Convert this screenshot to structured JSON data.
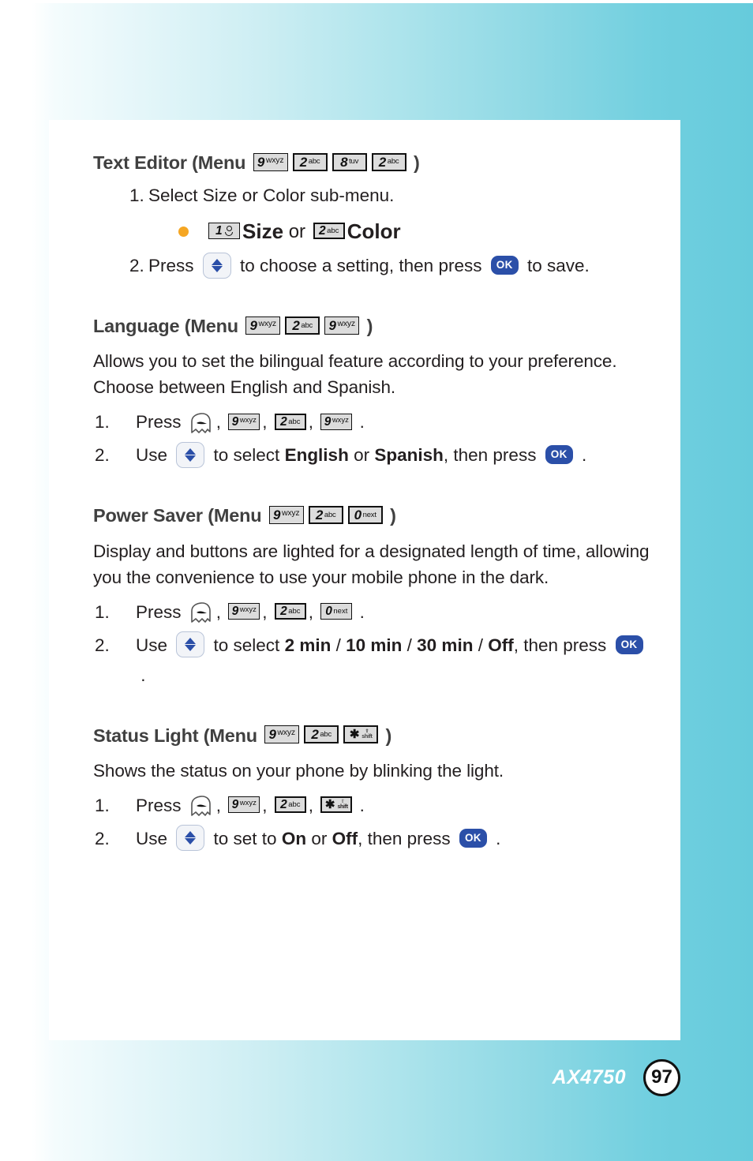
{
  "document": {
    "footer": {
      "model": "AX4750",
      "page_number": "97"
    }
  },
  "keys": {
    "k9": {
      "digit": "9",
      "letters": "wxyz"
    },
    "k2": {
      "digit": "2",
      "letters": "abc"
    },
    "k8": {
      "digit": "8",
      "letters": "tuv"
    },
    "k1": {
      "digit": "1",
      "letters": ""
    },
    "k0": {
      "digit": "0",
      "letters": "next"
    },
    "kstar": {
      "glyph": "✱",
      "label_top": "⇧",
      "label_bottom": "shift"
    },
    "ok": {
      "label": "OK"
    }
  },
  "sections": [
    {
      "id": "text-editor",
      "heading_prefix": "Text Editor (Menu ",
      "heading_suffix": " )",
      "heading_keys": [
        "9wxyz",
        "2abc",
        "8tuv",
        "2abc"
      ],
      "steps": [
        {
          "num": "1.",
          "text": "Select Size or Color sub-menu."
        },
        {
          "num": "2.",
          "parts": [
            "Press ",
            " to choose a setting, then press ",
            " to save."
          ]
        }
      ],
      "bullet": {
        "size_label": "Size",
        "or_label": " or ",
        "color_label": "Color"
      }
    },
    {
      "id": "language",
      "heading_prefix": "Language (Menu ",
      "heading_suffix": " )",
      "heading_keys": [
        "9wxyz",
        "2abc",
        "9wxyz"
      ],
      "body": "Allows you to set the bilingual feature according to your preference. Choose between English and Spanish.",
      "steps": [
        {
          "num": "1.",
          "label": "Press ",
          "tail": " ."
        },
        {
          "num": "2.",
          "label": "Use ",
          "mid_a": " to select ",
          "bold_a": "English",
          "mid_b": " or ",
          "bold_b": "Spanish",
          "mid_c": ", then press ",
          "tail": " ."
        }
      ]
    },
    {
      "id": "power-saver",
      "heading_prefix": "Power Saver (Menu ",
      "heading_suffix": " )",
      "heading_keys": [
        "9wxyz",
        "2abc",
        "0next"
      ],
      "body": "Display and buttons are lighted for a designated length of time, allowing you the convenience to use your mobile phone in the dark.",
      "steps": [
        {
          "num": "1.",
          "label": "Press ",
          "tail": " ."
        },
        {
          "num": "2.",
          "label": "Use ",
          "mid_a": " to select ",
          "bold_a": "2 min",
          "sep_a": " / ",
          "bold_b": "10 min",
          "sep_b": " / ",
          "bold_c": "30 min",
          "sep_c": " / ",
          "bold_d": "Off",
          "mid_b": ", then press ",
          "tail": " ."
        }
      ]
    },
    {
      "id": "status-light",
      "heading_prefix": "Status Light (Menu ",
      "heading_suffix": " )",
      "heading_keys": [
        "9wxyz",
        "2abc",
        "*shift"
      ],
      "body": "Shows the status on your phone by blinking the light.",
      "steps": [
        {
          "num": "1.",
          "label": "Press ",
          "tail": " ."
        },
        {
          "num": "2.",
          "label": "Use ",
          "mid_a": " to set to ",
          "bold_a": "On",
          "mid_b": " or ",
          "bold_b": "Off",
          "mid_c": ", then press ",
          "tail": " ."
        }
      ]
    }
  ],
  "colors": {
    "page_cyan": "#66cbdc",
    "heading_gray": "#404040",
    "bullet_orange": "#f5a623",
    "ok_blue": "#2b4fa8",
    "key_gray": "#dcdcdc"
  }
}
